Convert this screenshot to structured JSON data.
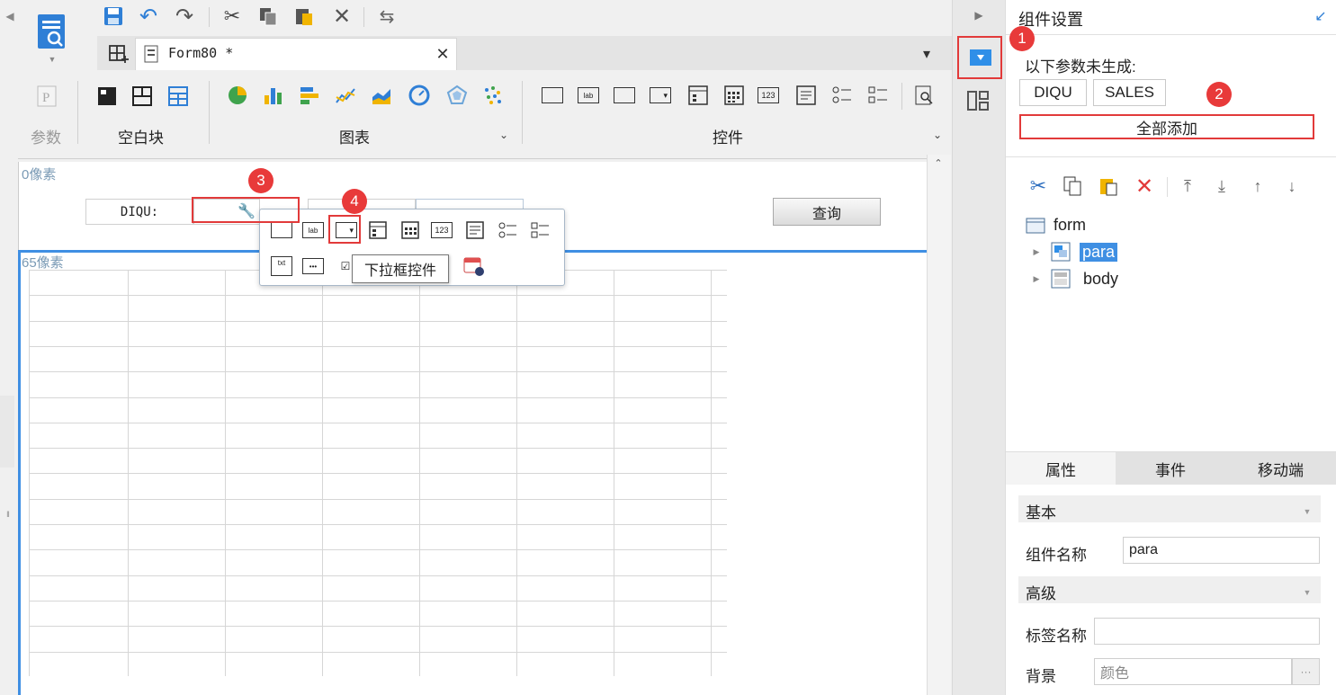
{
  "editor_tab": {
    "title": "Form80 *"
  },
  "toolbar": {
    "groups": [
      {
        "label": "参数"
      },
      {
        "label": "空白块"
      },
      {
        "label": "图表"
      },
      {
        "label": "控件"
      }
    ]
  },
  "canvas": {
    "para_marker": "0像素",
    "body_marker": "65像素",
    "param_label": "DIQU:",
    "query_button": "查询",
    "tooltip": "下拉框控件"
  },
  "panel": {
    "title": "组件设置",
    "not_generated": "以下参数未生成:",
    "params": [
      "DIQU",
      "SALES"
    ],
    "add_all": "全部添加",
    "tree": {
      "root": "form",
      "children": [
        "para",
        "body"
      ]
    },
    "tabs": [
      "属性",
      "事件",
      "移动端"
    ],
    "sections": {
      "basic": "基本",
      "advanced": "高级"
    },
    "fields": {
      "component_name_label": "组件名称",
      "component_name_value": "para",
      "tag_name_label": "标签名称",
      "tag_name_value": "",
      "background_label": "背景",
      "background_value": "颜色",
      "background_more": "···"
    }
  },
  "badges": [
    "1",
    "2",
    "3",
    "4"
  ],
  "colors": {
    "accent": "#3b8ee8",
    "highlight_red": "#e23a3a",
    "selection": "#3f8fe3"
  }
}
